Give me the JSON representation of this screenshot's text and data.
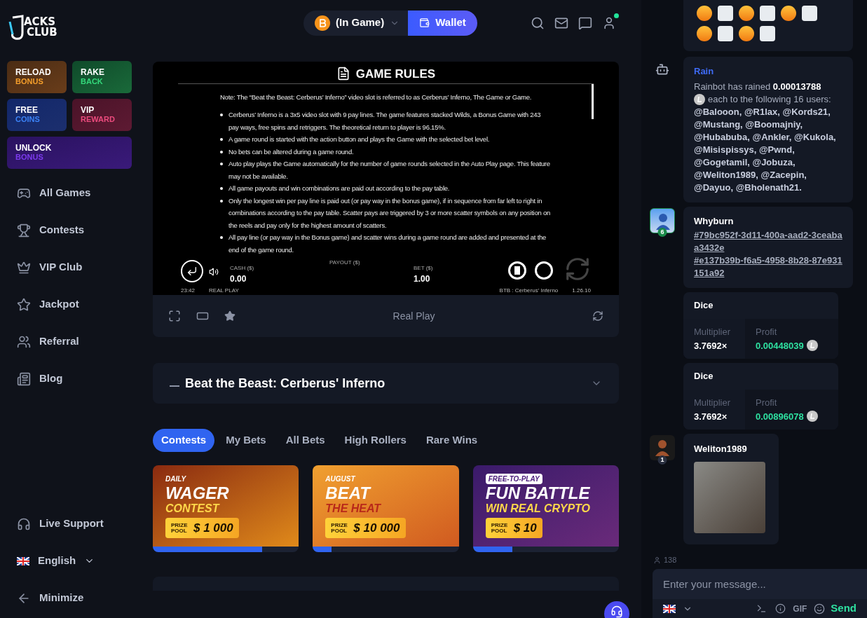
{
  "logo": {
    "line1": "ACKS",
    "line2": "CLUB"
  },
  "promo_tiles": [
    {
      "title": "RELOAD",
      "subtitle": "BONUS",
      "color": "#f59e2b"
    },
    {
      "title": "RAKE",
      "subtitle": "BACK",
      "color": "#34d97b"
    },
    {
      "title": "FREE",
      "subtitle": "COINS",
      "color": "#3b82f6"
    },
    {
      "title": "VIP",
      "subtitle": "REWARD",
      "color": "#ec4b7e"
    },
    {
      "title": "UNLOCK",
      "subtitle": "BONUS",
      "color": "#7c3aed"
    }
  ],
  "nav": [
    {
      "label": "All Games"
    },
    {
      "label": "Contests"
    },
    {
      "label": "VIP Club"
    },
    {
      "label": "Jackpot"
    },
    {
      "label": "Referral"
    },
    {
      "label": "Blog"
    }
  ],
  "sidebar_footer": {
    "support": "Live Support",
    "language": "English",
    "minimize": "Minimize"
  },
  "header": {
    "balance": "(In Game)",
    "wallet": "Wallet",
    "notification": true
  },
  "game": {
    "rules_title": "GAME RULES",
    "note": "Note: The “Beat the Beast: Cerberus’ Inferno” video slot is referred to as Cerberus’ Inferno, The Game or Game.",
    "rules": [
      "Cerberus’ Inferno is a 3x5 video slot with 9 pay lines. The game features stacked Wilds, a Bonus Game with 243 pay ways, free spins and retriggers. The theoretical return to player is 96.15%.",
      "A game round is started with the action button and plays the Game with the selected bet level.",
      "No bets can be altered during a game round.",
      "Auto play plays the Game automatically for the number of game rounds selected in the Auto Play page. This feature may not be available.",
      "All game payouts and win combinations are paid out according to the pay table.",
      "Only the longest win per pay line is paid out (or pay way in the bonus game), if in sequence from far left to right in combinations according to the pay table. Scatter pays are triggered by 3 or more scatter symbols on any position on the reels and pay only for the highest amount of scatters.",
      "All pay line (or pay way in the Bonus game) and scatter wins during a game round are added and presented at the end of the game round."
    ],
    "cash_label": "CASH ($)",
    "cash": "0.00",
    "payout_label": "PAYOUT ($)",
    "bet_label": "BET ($)",
    "bet": "1.00",
    "time": "23:42",
    "mode": "REAL PLAY",
    "game_id": "BTB : Cerberus’ Inferno",
    "version": "1.26.10"
  },
  "toolbar": {
    "mode": "Real Play"
  },
  "game_title": "Beat the Beast: Cerberus' Inferno",
  "tabs": [
    {
      "label": "Contests",
      "selected": true
    },
    {
      "label": "My Bets",
      "selected": false
    },
    {
      "label": "All Bets",
      "selected": false
    },
    {
      "label": "High Rollers",
      "selected": false
    },
    {
      "label": "Rare Wins",
      "selected": false
    }
  ],
  "contests": [
    {
      "tag": "DAILY",
      "title": "WAGER",
      "subtitle": "CONTEST",
      "prize_label": "PRIZE POOL",
      "prize": "$ 1 000",
      "level": 0.75
    },
    {
      "tag": "AUGUST",
      "title": "BEAT",
      "subtitle": "THE HEAT",
      "prize_label": "PRIZE POOL",
      "prize": "$ 10 000",
      "level": 0.13
    },
    {
      "tag": "FREE-TO-PLAY",
      "title": "FUN BATTLE",
      "subtitle": "WIN REAL CRYPTO",
      "prize_label": "PRIZE POOL",
      "prize": "$ 10",
      "level": 0.27
    }
  ],
  "chat": [
    {
      "kind": "emoji_grid"
    },
    {
      "kind": "rain",
      "title": "Rain",
      "amount": "Rainbot has rained **0.00013788**",
      "after": "each to the following 16 users:",
      "users": "@Balooon, @R1lax, @Kords21, @Mustang, @Boomajniy, @Hubabuba, @Ankler, @Kukola, @Misispissys, @Pwnd, @Gogetamil, @Jobuza, @Weliton1989, @Zacepin, @Dayuo, @Bholenath21."
    },
    {
      "kind": "links",
      "user": "Whyburn",
      "level": "6",
      "links": [
        "#79bc952f-3d11-400a-aad2-3ceabaa3432e",
        "#e137b39b-f6a5-4958-8b28-87e931151a92"
      ]
    },
    {
      "kind": "bet",
      "game": "Dice",
      "multiplier_label": "Multiplier",
      "multiplier": "3.7692×",
      "profit_label": "Profit",
      "profit": "0.00448039"
    },
    {
      "kind": "bet",
      "game": "Dice",
      "multiplier_label": "Multiplier",
      "multiplier": "3.7692×",
      "profit_label": "Profit",
      "profit": "0.00896078"
    },
    {
      "kind": "gif",
      "user": "Weliton1989",
      "level": "1"
    }
  ],
  "chat_footer": {
    "online": "138",
    "placeholder": "Enter your message...",
    "gif": "GIF",
    "send": "Send"
  }
}
